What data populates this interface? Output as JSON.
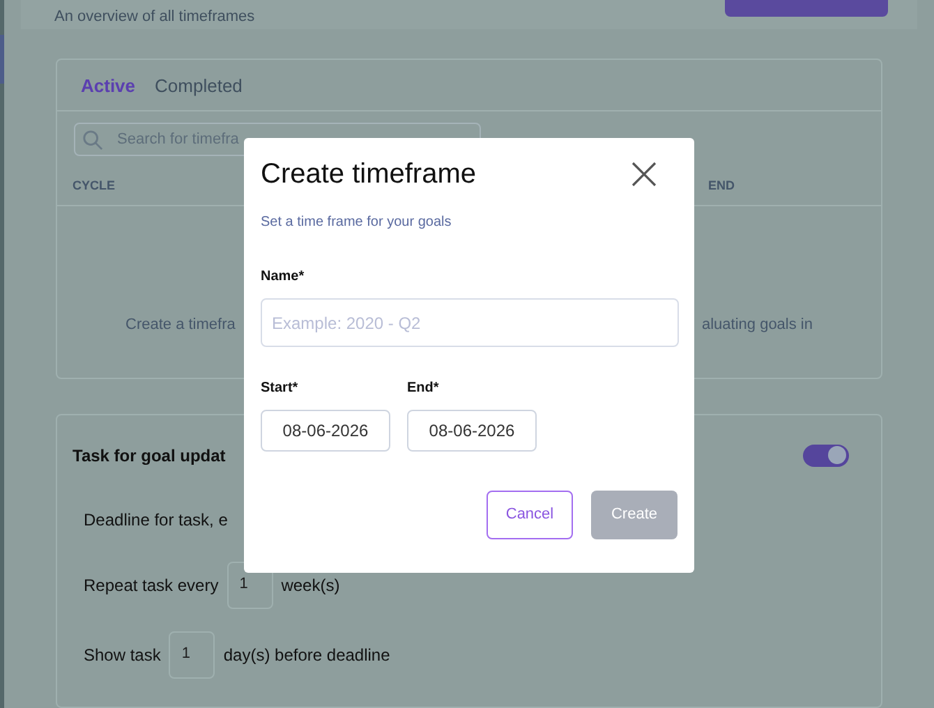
{
  "page": {
    "subtitle": "An overview of all timeframes"
  },
  "timeframes": {
    "tabs": [
      {
        "label": "Active",
        "selected": true
      },
      {
        "label": "Completed",
        "selected": false
      }
    ],
    "search": {
      "placeholder": "Search for timefra"
    },
    "columns": [
      "CYCLE",
      "END"
    ],
    "empty_text": [
      "Create a timefra",
      "aluating goals in"
    ]
  },
  "goal_update_task": {
    "title": "Task for goal updat",
    "on": true,
    "deadline_label": "Deadline for task, e",
    "repeat": {
      "before": "Repeat task every",
      "value": "1",
      "after": "week(s)"
    },
    "show": {
      "before": "Show task",
      "value": "1",
      "after": "day(s) before deadline"
    }
  },
  "dialog": {
    "title": "Create timeframe",
    "subtitle": "Set a time frame for your goals",
    "name": {
      "label": "Name*",
      "placeholder": "Example: 2020 - Q2"
    },
    "start": {
      "label": "Start*",
      "value": "08-06-2026"
    },
    "end": {
      "label": "End*",
      "value": "08-06-2026"
    },
    "buttons": [
      {
        "label": "Cancel",
        "kind": "secondary",
        "disabled": false
      },
      {
        "label": "Create",
        "kind": "primary",
        "disabled": true
      }
    ]
  }
}
